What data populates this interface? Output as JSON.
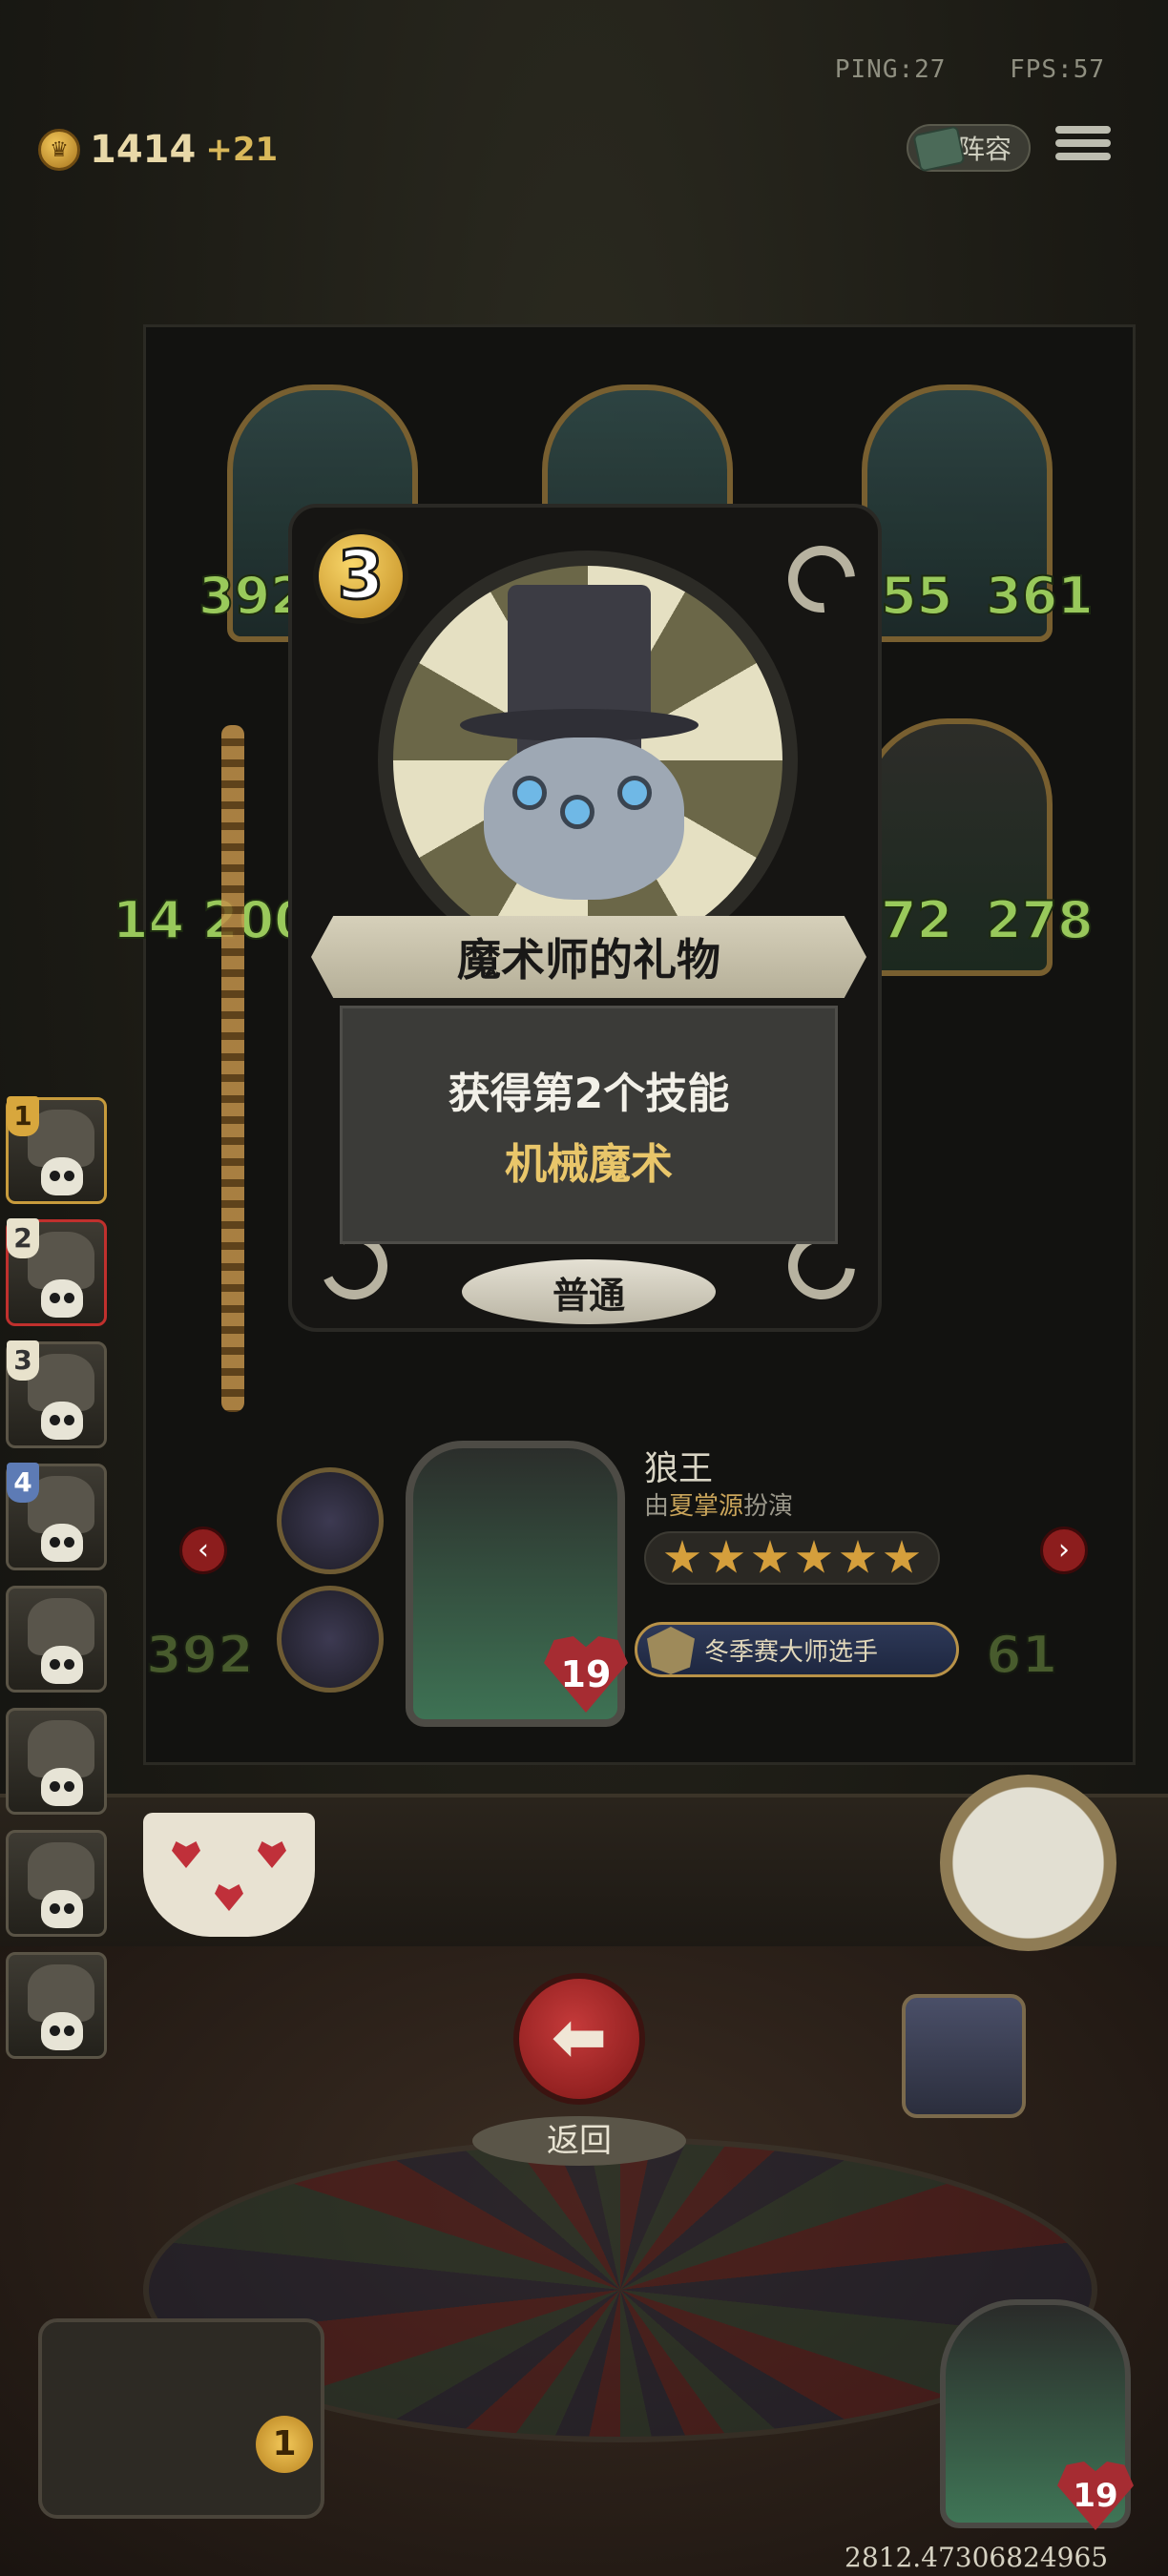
{
  "hud": {
    "ping": "PING:27",
    "fps": "FPS:57",
    "coins": "1414",
    "coins_gain": "+21",
    "lineup_label": "阵容"
  },
  "side_slots": [
    {
      "num": "1"
    },
    {
      "num": "2"
    },
    {
      "num": "3"
    },
    {
      "num": "4"
    },
    {
      "num": ""
    },
    {
      "num": ""
    },
    {
      "num": ""
    },
    {
      "num": ""
    }
  ],
  "panel_stats": {
    "top_left": "392",
    "top_right_a": "55",
    "top_right_b": "361",
    "mid_left": "14 2000",
    "mid_right_a": "72",
    "mid_right_b": "278",
    "low_left": "392",
    "low_right": "61"
  },
  "skill_card": {
    "cost": "3",
    "title": "魔术师的礼物",
    "desc_line1": "获得第2个技能",
    "desc_line2": "机械魔术",
    "rarity": "普通"
  },
  "hero": {
    "name": "狼王",
    "actor_prefix": "由",
    "actor_name": "夏掌源",
    "actor_suffix": "扮演",
    "stars": 6,
    "level": "19",
    "badge": "冬季赛大师选手"
  },
  "back_label": "返回",
  "bottom_left_count": "1",
  "bottom_right_level": "19",
  "coordinate_readout": "2812.47306824965",
  "colors": {
    "accent_gold": "#e9c66a",
    "stat_green": "#9ed05e",
    "red_button": "#c53a3a"
  }
}
